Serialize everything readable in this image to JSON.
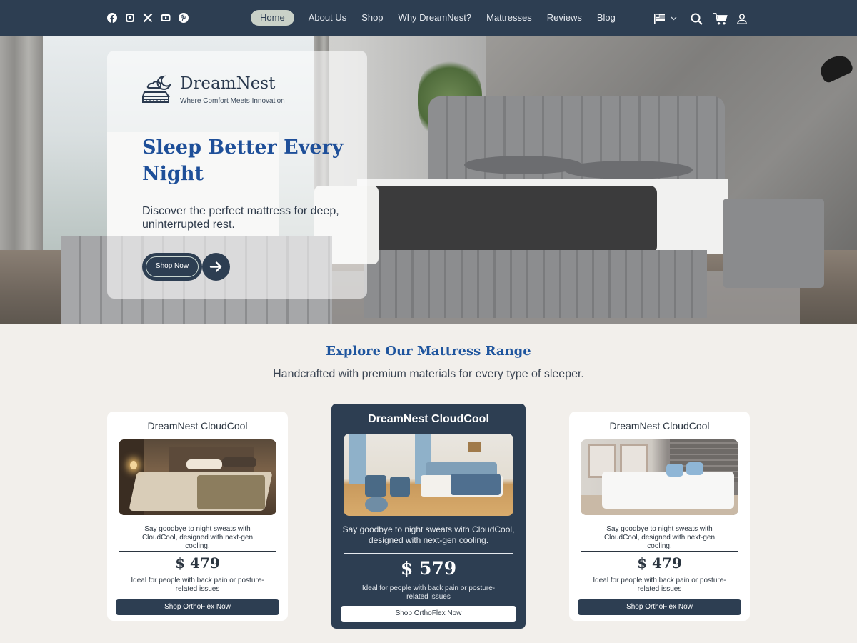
{
  "nav": {
    "menu": [
      {
        "label": "Home",
        "active": true
      },
      {
        "label": "About Us",
        "active": false
      },
      {
        "label": "Shop",
        "active": false
      },
      {
        "label": "Why DreamNest?",
        "active": false
      },
      {
        "label": "Mattresses",
        "active": false
      },
      {
        "label": "Reviews",
        "active": false
      },
      {
        "label": "Blog",
        "active": false
      }
    ],
    "social_icons": [
      "facebook-icon",
      "instagram-icon",
      "x-icon",
      "youtube-icon",
      "pinterest-icon"
    ],
    "right_icons": [
      "flag-icon",
      "chevron-down-icon",
      "search-icon",
      "cart-icon",
      "user-icon"
    ]
  },
  "hero": {
    "brand": "DreamNest",
    "tagline": "Where Comfort Meets Innovation",
    "title": "Sleep Better Every Night",
    "subtitle": "Discover the perfect mattress for deep, uninterrupted rest.",
    "cta_label": "Shop Now"
  },
  "range": {
    "title": "Explore Our Mattress Range",
    "subtitle": "Handcrafted with premium materials for every type of sleeper."
  },
  "cards": [
    {
      "name": "DreamNest CloudCool",
      "description": "Say goodbye to night sweats with CloudCool, designed with next-gen cooling.",
      "price": "$ 479",
      "note": "Ideal for people with back pain or posture-related issues",
      "button": "Shop OrthoFlex Now"
    },
    {
      "name": "DreamNest CloudCool",
      "description": "Say goodbye to night sweats with CloudCool, designed with next-gen cooling.",
      "price": "$ 579",
      "note": "Ideal for people with back pain or posture-related issues",
      "button": "Shop OrthoFlex Now"
    },
    {
      "name": "DreamNest CloudCool",
      "description": "Say goodbye to night sweats with CloudCool, designed with next-gen cooling.",
      "price": "$ 479",
      "note": "Ideal for people with back pain or posture-related issues",
      "button": "Shop OrthoFlex Now"
    }
  ],
  "colors": {
    "navy": "#2d3e52",
    "heading_blue": "#1f559e",
    "page_bg": "#f2efeb",
    "active_pill": "#c9d1c8"
  }
}
